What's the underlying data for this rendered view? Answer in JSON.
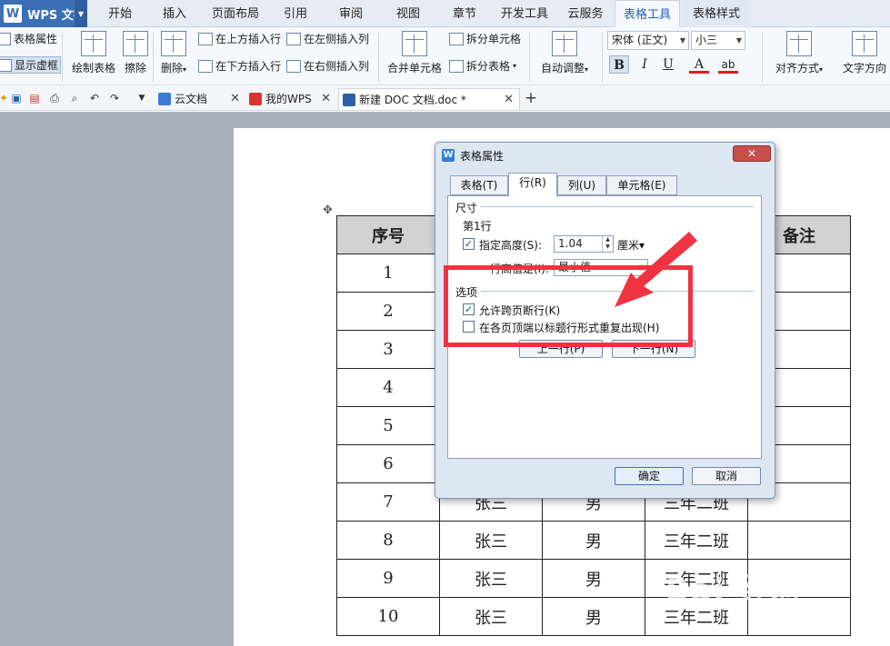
{
  "app": {
    "name": "WPS 文字",
    "logo": "W"
  },
  "menu_tabs": [
    {
      "label": "开始"
    },
    {
      "label": "插入"
    },
    {
      "label": "页面布局"
    },
    {
      "label": "引用"
    },
    {
      "label": "审阅"
    },
    {
      "label": "视图"
    },
    {
      "label": "章节"
    },
    {
      "label": "开发工具"
    },
    {
      "label": "云服务"
    },
    {
      "label": "表格工具"
    },
    {
      "label": "表格样式"
    }
  ],
  "ribbon": {
    "table_props": "表格属性",
    "show_grid": "显示虚框",
    "draw_table": "绘制表格",
    "erase": "擦除",
    "delete": "删除",
    "insert_above": "在上方插入行",
    "insert_below": "在下方插入行",
    "insert_left": "在左侧插入列",
    "insert_right": "在右侧插入列",
    "merge_cells": "合并单元格",
    "split_cells": "拆分单元格",
    "split_table": "拆分表格",
    "auto_fit": "自动调整",
    "font_name": "宋体 (正文)",
    "font_size": "小三",
    "bold": "B",
    "italic": "I",
    "underline": "U",
    "font_color": "A",
    "highlight": "ab",
    "align": "对齐方式",
    "text_dir": "文字方向"
  },
  "doc_tabs": [
    {
      "label": "云文档",
      "icon": "cloud-icon"
    },
    {
      "label": "我的WPS",
      "icon": "wps-icon"
    },
    {
      "label": "新建 DOC 文档.doc *",
      "icon": "doc-icon"
    }
  ],
  "table": {
    "headers": [
      "序号",
      "",
      "",
      "",
      "备注"
    ],
    "rows": [
      [
        "1",
        "",
        "",
        "",
        ""
      ],
      [
        "2",
        "",
        "",
        "",
        ""
      ],
      [
        "3",
        "",
        "",
        "",
        ""
      ],
      [
        "4",
        "",
        "",
        "",
        ""
      ],
      [
        "5",
        "",
        "",
        "",
        ""
      ],
      [
        "6",
        "",
        "",
        "",
        ""
      ],
      [
        "7",
        "张三",
        "男",
        "三年二班",
        ""
      ],
      [
        "8",
        "张三",
        "男",
        "三年二班",
        ""
      ],
      [
        "9",
        "张三",
        "男",
        "三年二班",
        ""
      ],
      [
        "10",
        "张三",
        "男",
        "三年二班",
        ""
      ]
    ]
  },
  "dialog": {
    "title": "表格属性",
    "close": "✕",
    "tabs": [
      "表格(T)",
      "行(R)",
      "列(U)",
      "单元格(E)"
    ],
    "size_group": "尺寸",
    "row_label": "第1行",
    "specify_height": "指定高度(S):",
    "height_value": "1.04",
    "height_unit": "厘米▾",
    "row_height_label": "行高值是(I):",
    "row_height_value": "最小值",
    "options_group": "选项",
    "allow_break": "允许跨页断行(K)",
    "repeat_header": "在各页顶端以标题行形式重复出现(H)",
    "prev_row": "上一行(P)",
    "next_row": "下一行(N)",
    "ok": "确定",
    "cancel": "取消"
  },
  "watermark": "Bai 经验",
  "colors": {
    "annotation": "#ef3340",
    "brand": "#3b6fb6"
  }
}
